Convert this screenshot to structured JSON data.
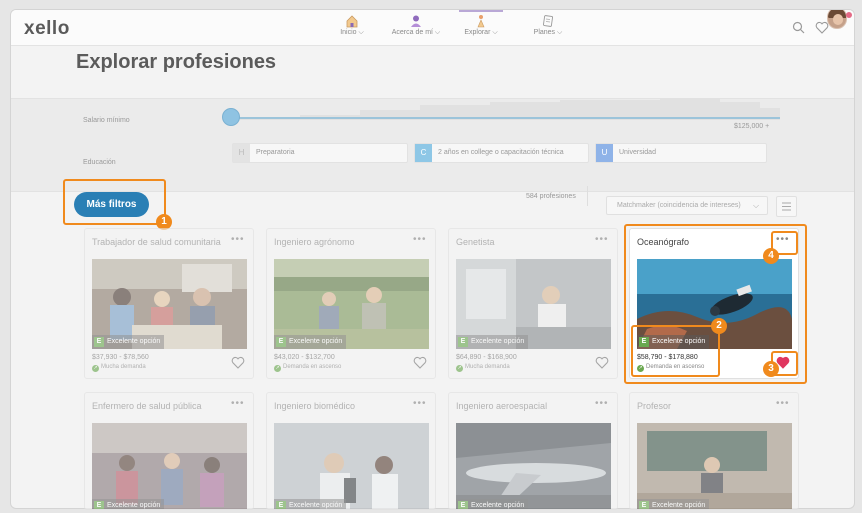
{
  "app": {
    "logo": "xello"
  },
  "nav": [
    {
      "label": "Inicio",
      "icon": "home-icon"
    },
    {
      "label": "Acerca de mí",
      "icon": "user-icon"
    },
    {
      "label": "Explorar",
      "icon": "explore-icon",
      "active": true
    },
    {
      "label": "Planes",
      "icon": "plans-icon"
    }
  ],
  "header_icons": [
    "search-icon",
    "heart-icon",
    "avatar"
  ],
  "page": {
    "title": "Explorar profesiones"
  },
  "filters": {
    "salary": {
      "label": "Salario mínimo",
      "min_text": "$0",
      "max_text": "$125,000 +",
      "value_fraction": 0
    },
    "education": {
      "label": "Educación",
      "options": [
        {
          "code": "H",
          "text": "Preparatoria",
          "color": "#e3e3e3"
        },
        {
          "code": "C",
          "text": "2 años en college o capacitación técnica",
          "color": "#8ec7e6"
        },
        {
          "code": "U",
          "text": "Universidad",
          "color": "#8fb3e8"
        }
      ]
    }
  },
  "toolbar": {
    "more_filters": "Más filtros",
    "count": "584 profesiones",
    "sort": "Matchmaker (coincidencia de intereses)"
  },
  "callouts": [
    "1",
    "2",
    "3",
    "4"
  ],
  "cards": [
    {
      "title": "Trabajador de salud comunitaria",
      "fit": "Excelente opción",
      "fit_code": "E",
      "salary": "$37,930 - $78,560",
      "demand": "Mucha demanda",
      "favorited": false,
      "image": "classroom-photo"
    },
    {
      "title": "Ingeniero agrónomo",
      "fit": "Excelente opción",
      "fit_code": "E",
      "salary": "$43,020 - $132,700",
      "demand": "Demanda en ascenso",
      "favorited": false,
      "image": "field-photo"
    },
    {
      "title": "Genetista",
      "fit": "Excelente opción",
      "fit_code": "E",
      "salary": "$64,890 - $168,900",
      "demand": "Mucha demanda",
      "favorited": false,
      "image": "lab-photo"
    },
    {
      "title": "Oceanógrafo",
      "fit": "Excelente opción",
      "fit_code": "E",
      "salary": "$58,790 - $178,880",
      "demand": "Demanda en ascenso",
      "favorited": true,
      "image": "diver-photo"
    },
    {
      "title": "Enfermero de salud pública",
      "fit": "Excelente opción",
      "fit_code": "E",
      "image": "clinic-photo"
    },
    {
      "title": "Ingeniero biomédico",
      "fit": "Excelente opción",
      "fit_code": "E",
      "image": "microscope-photo"
    },
    {
      "title": "Ingeniero aeroespacial",
      "fit": "Excelente opción",
      "fit_code": "E",
      "image": "aircraft-photo"
    },
    {
      "title": "Profesor",
      "fit": "Excelente opción",
      "fit_code": "E",
      "image": "lecture-photo"
    }
  ],
  "colors": {
    "accent": "#2a7fb5",
    "callout": "#f08a1d",
    "favorite": "#e0365f",
    "fit_green": "#6aa84f"
  }
}
